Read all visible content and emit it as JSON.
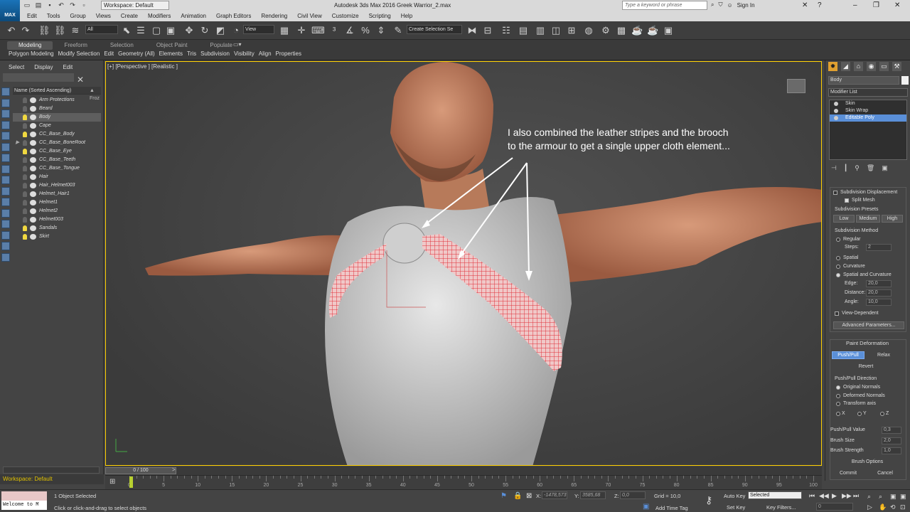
{
  "titlebar": {
    "logo": "MAX",
    "workspace": "Workspace: Default",
    "title": "Autodesk 3ds Max 2016     Greek Warrior_2.max",
    "search_placeholder": "Type a keyword or phrase",
    "sign_in": "Sign In"
  },
  "menu": [
    "Edit",
    "Tools",
    "Group",
    "Views",
    "Create",
    "Modifiers",
    "Animation",
    "Graph Editors",
    "Rendering",
    "Civil View",
    "Customize",
    "Scripting",
    "Help"
  ],
  "toolbar": {
    "selection_filter": "All",
    "ref_coord": "View",
    "named_selection": "Create Selection Se"
  },
  "ribbon": {
    "tabs": [
      "Modeling",
      "Freeform",
      "Selection",
      "Object Paint",
      "Populate"
    ],
    "active_tab": "Modeling",
    "subs": [
      "Polygon Modeling",
      "Modify Selection",
      "Edit",
      "Geometry (All)",
      "Elements",
      "Tris",
      "Subdivision",
      "Visibility",
      "Align",
      "Properties"
    ]
  },
  "explorer": {
    "tabs": [
      "Select",
      "Display",
      "Edit"
    ],
    "column_name": "Name (Sorted Ascending)",
    "column_frozen": "▲ Froz",
    "items": [
      {
        "name": "Arm Protections",
        "bulb": false
      },
      {
        "name": "Beard",
        "bulb": false
      },
      {
        "name": "Body",
        "bulb": true,
        "selected": true
      },
      {
        "name": "Cape",
        "bulb": false
      },
      {
        "name": "CC_Base_Body",
        "bulb": true
      },
      {
        "name": "CC_Base_BoneRoot",
        "bulb": false,
        "expand": true
      },
      {
        "name": "CC_Base_Eye",
        "bulb": true
      },
      {
        "name": "CC_Base_Teeth",
        "bulb": false
      },
      {
        "name": "CC_Base_Tongue",
        "bulb": false
      },
      {
        "name": "Hair",
        "bulb": false
      },
      {
        "name": "Hair_Helmet003",
        "bulb": false
      },
      {
        "name": "Helmet_Hair1",
        "bulb": false
      },
      {
        "name": "Helmet1",
        "bulb": false
      },
      {
        "name": "Helmet2",
        "bulb": false
      },
      {
        "name": "Helmet003",
        "bulb": false
      },
      {
        "name": "Sandals",
        "bulb": true
      },
      {
        "name": "Skirt",
        "bulb": true
      }
    ]
  },
  "viewport": {
    "label": "[+] [Perspective ] [Realistic ]",
    "annotation_line1": "I also combined the leather stripes and the brooch",
    "annotation_line2": "to the armour to get a single upper cloth element..."
  },
  "command_panel": {
    "object_name": "Body",
    "modifier_list": "Modifier List",
    "stack": [
      {
        "name": "Skin",
        "selected": false
      },
      {
        "name": "Skin Wrap",
        "selected": false
      },
      {
        "name": "Editable Poly",
        "selected": true
      }
    ],
    "subdiv_displacement": "Subdivision Displacement",
    "split_mesh": "Split Mesh",
    "presets_label": "Subdivision Presets",
    "presets": [
      "Low",
      "Medium",
      "High"
    ],
    "method_label": "Subdivision Method",
    "regular": "Regular",
    "steps_label": "Steps:",
    "steps_value": "2",
    "spatial": "Spatial",
    "curvature": "Curvature",
    "spatial_curvature": "Spatial and Curvature",
    "edge_label": "Edge:",
    "edge_value": "20,0",
    "distance_label": "Distance:",
    "distance_value": "20,0",
    "angle_label": "Angle:",
    "angle_value": "10,0",
    "view_dependent": "View-Dependent",
    "advanced_params": "Advanced Parameters...",
    "paint_deformation": "Paint Deformation",
    "push_pull": "Push/Pull",
    "relax": "Relax",
    "revert": "Revert",
    "direction_label": "Push/Pull Direction",
    "original_normals": "Original Normals",
    "deformed_normals": "Deformed Normals",
    "transform_axis": "Transform axis",
    "axes": [
      "X",
      "Y",
      "Z"
    ],
    "push_pull_value_label": "Push/Pull Value",
    "push_pull_value": "0,3",
    "brush_size_label": "Brush Size",
    "brush_size": "2,0",
    "brush_strength_label": "Brush Strength",
    "brush_strength": "1,0",
    "brush_options": "Brush Options",
    "commit": "Commit",
    "cancel": "Cancel"
  },
  "timeline": {
    "frame_display": "0 / 100",
    "ticks": [
      "0",
      "5",
      "10",
      "15",
      "20",
      "25",
      "30",
      "35",
      "40",
      "45",
      "50",
      "55",
      "60",
      "65",
      "70",
      "75",
      "80",
      "85",
      "90",
      "95",
      "100"
    ]
  },
  "status": {
    "workspace": "Workspace: Default",
    "maxscript": "Welcome to M",
    "objects_selected": "1 Object Selected",
    "prompt": "Click or click-and-drag to select objects",
    "x_label": "X:",
    "x_value": "-1478,573",
    "y_label": "Y:",
    "y_value": "3585,68",
    "z_label": "Z:",
    "z_value": "0,0",
    "grid": "Grid = 10,0",
    "add_time_tag": "Add Time Tag",
    "auto_key": "Auto Key",
    "set_key": "Set Key",
    "selected": "Selected",
    "key_filters": "Key Filters...",
    "frame": "0"
  },
  "colors": {
    "accent_blue": "#5a8fd8",
    "viewport_border": "#ffd000",
    "mesh_red": "#e0303a"
  }
}
